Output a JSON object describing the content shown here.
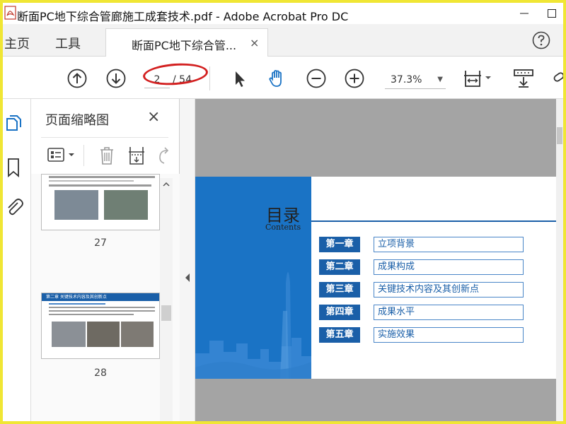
{
  "window": {
    "title": "断面PC地下综合管廊施工成套技术.pdf - Adobe Acrobat Pro DC"
  },
  "tabs": {
    "home_label": "主页",
    "tools_label": "工具",
    "document_tab_label": "断面PC地下综合管...",
    "document_tab_close": "×",
    "help_icon": "help-circle-icon"
  },
  "toolbar": {
    "current_page": "2",
    "page_total": "/ 54",
    "zoom_level": "37.3%"
  },
  "thumbnails_panel": {
    "title": "页面缩略图",
    "close": "×",
    "pages": [
      {
        "number": "27"
      },
      {
        "number": "28",
        "heading": "第二章  关键技术内容及其创新点"
      }
    ]
  },
  "slide": {
    "title": "目录",
    "subtitle": "Contents",
    "toc": [
      {
        "chapter": "第一章",
        "text": "立项背景"
      },
      {
        "chapter": "第二章",
        "text": "成果构成"
      },
      {
        "chapter": "第三章",
        "text": "关键技术内容及其创新点"
      },
      {
        "chapter": "第四章",
        "text": "成果水平"
      },
      {
        "chapter": "第五章",
        "text": "实施效果"
      }
    ]
  },
  "colors": {
    "accent_blue": "#1a73c5",
    "chapter_blue": "#1a5fa8",
    "annotation_red": "#d32020",
    "frame_yellow": "#f0e634"
  }
}
